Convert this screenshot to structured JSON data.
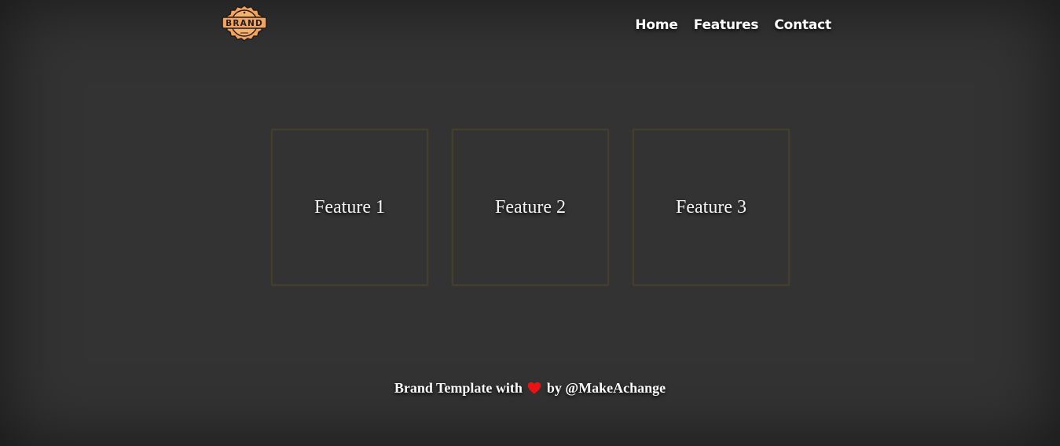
{
  "header": {
    "logo_text": "BRAND",
    "nav": [
      {
        "label": "Home"
      },
      {
        "label": "Features"
      },
      {
        "label": "Contact"
      }
    ]
  },
  "features": [
    {
      "label": "Feature 1"
    },
    {
      "label": "Feature 2"
    },
    {
      "label": "Feature 3"
    }
  ],
  "footer": {
    "text_before": "Brand Template with",
    "icon": "heart-icon",
    "text_after": "by @MakeAchange"
  },
  "colors": {
    "background": "#333333",
    "logo_orange": "#f5a35c",
    "heart_red": "#ee1111",
    "feature_border": "#463e2c"
  }
}
